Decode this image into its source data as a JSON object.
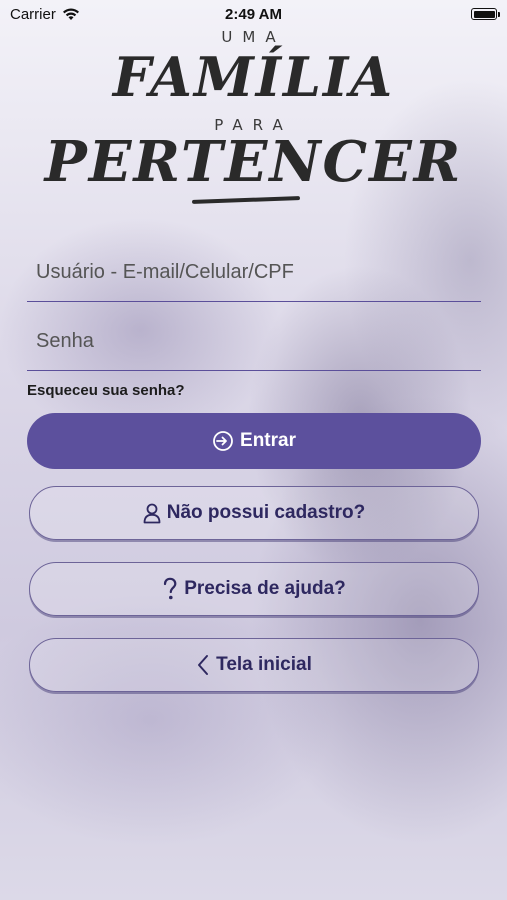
{
  "status_bar": {
    "carrier": "Carrier",
    "time": "2:49 AM"
  },
  "logo": {
    "line1": "UMA",
    "line2": "FAMÍLIA",
    "line3": "PARA",
    "line4": "PERTENCER"
  },
  "form": {
    "user_placeholder": "Usuário - E-mail/Celular/CPF",
    "password_placeholder": "Senha",
    "forgot_label": "Esqueceu sua senha?"
  },
  "buttons": {
    "login": "Entrar",
    "register": "Não possui cadastro?",
    "help": "Precisa de ajuda?",
    "home": "Tela inicial"
  },
  "colors": {
    "accent": "#5c509d",
    "outline_text": "#2e2860"
  }
}
